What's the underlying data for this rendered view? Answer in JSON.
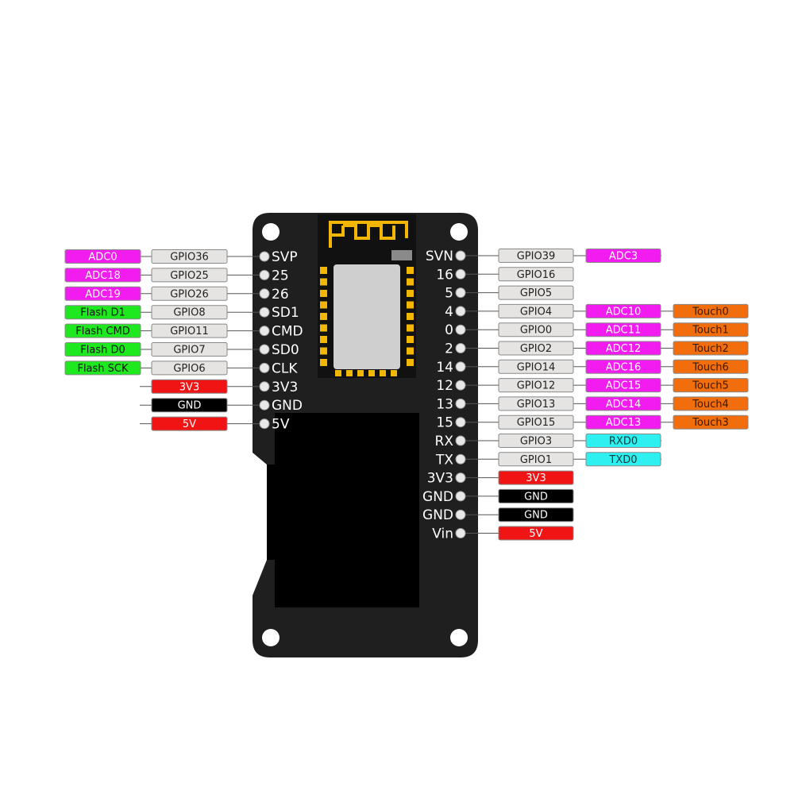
{
  "colors": {
    "board": "#1f1f1f",
    "screen": "#000000",
    "gold": "#f2b705",
    "gpio": "#e6e4e2",
    "adc": "#f21bf0",
    "flash": "#1ee81e",
    "power": "#f01414",
    "gnd": "#000000",
    "touch": "#f26d0c",
    "uart": "#2ef0f0"
  },
  "left_pins": [
    {
      "pin": "SVP",
      "tags": [
        {
          "text": "GPIO36",
          "type": "gpio"
        },
        {
          "text": "ADC0",
          "type": "adc"
        }
      ]
    },
    {
      "pin": "25",
      "tags": [
        {
          "text": "GPIO25",
          "type": "gpio"
        },
        {
          "text": "ADC18",
          "type": "adc"
        }
      ]
    },
    {
      "pin": "26",
      "tags": [
        {
          "text": "GPIO26",
          "type": "gpio"
        },
        {
          "text": "ADC19",
          "type": "adc"
        }
      ]
    },
    {
      "pin": "SD1",
      "tags": [
        {
          "text": "GPIO8",
          "type": "gpio"
        },
        {
          "text": "Flash D1",
          "type": "flash"
        }
      ]
    },
    {
      "pin": "CMD",
      "tags": [
        {
          "text": "GPIO11",
          "type": "gpio"
        },
        {
          "text": "Flash CMD",
          "type": "flash"
        }
      ]
    },
    {
      "pin": "SD0",
      "tags": [
        {
          "text": "GPIO7",
          "type": "gpio"
        },
        {
          "text": "Flash D0",
          "type": "flash"
        }
      ]
    },
    {
      "pin": "CLK",
      "tags": [
        {
          "text": "GPIO6",
          "type": "gpio"
        },
        {
          "text": "Flash SCK",
          "type": "flash"
        }
      ]
    },
    {
      "pin": "3V3",
      "tags": [
        {
          "text": "3V3",
          "type": "power"
        }
      ]
    },
    {
      "pin": "GND",
      "tags": [
        {
          "text": "GND",
          "type": "gnd"
        }
      ]
    },
    {
      "pin": "5V",
      "tags": [
        {
          "text": "5V",
          "type": "power"
        }
      ]
    }
  ],
  "right_pins": [
    {
      "pin": "SVN",
      "tags": [
        {
          "text": "GPIO39",
          "type": "gpio"
        },
        {
          "text": "ADC3",
          "type": "adc"
        }
      ]
    },
    {
      "pin": "16",
      "tags": [
        {
          "text": "GPIO16",
          "type": "gpio"
        }
      ]
    },
    {
      "pin": "5",
      "tags": [
        {
          "text": "GPIO5",
          "type": "gpio"
        }
      ]
    },
    {
      "pin": "4",
      "tags": [
        {
          "text": "GPIO4",
          "type": "gpio"
        },
        {
          "text": "ADC10",
          "type": "adc"
        },
        {
          "text": "Touch0",
          "type": "touch"
        }
      ]
    },
    {
      "pin": "0",
      "tags": [
        {
          "text": "GPIO0",
          "type": "gpio"
        },
        {
          "text": "ADC11",
          "type": "adc"
        },
        {
          "text": "Touch1",
          "type": "touch"
        }
      ]
    },
    {
      "pin": "2",
      "tags": [
        {
          "text": "GPIO2",
          "type": "gpio"
        },
        {
          "text": "ADC12",
          "type": "adc"
        },
        {
          "text": "Touch2",
          "type": "touch"
        }
      ]
    },
    {
      "pin": "14",
      "tags": [
        {
          "text": "GPIO14",
          "type": "gpio"
        },
        {
          "text": "ADC16",
          "type": "adc"
        },
        {
          "text": "Touch6",
          "type": "touch"
        }
      ]
    },
    {
      "pin": "12",
      "tags": [
        {
          "text": "GPIO12",
          "type": "gpio"
        },
        {
          "text": "ADC15",
          "type": "adc"
        },
        {
          "text": "Touch5",
          "type": "touch"
        }
      ]
    },
    {
      "pin": "13",
      "tags": [
        {
          "text": "GPIO13",
          "type": "gpio"
        },
        {
          "text": "ADC14",
          "type": "adc"
        },
        {
          "text": "Touch4",
          "type": "touch"
        }
      ]
    },
    {
      "pin": "15",
      "tags": [
        {
          "text": "GPIO15",
          "type": "gpio"
        },
        {
          "text": "ADC13",
          "type": "adc"
        },
        {
          "text": "Touch3",
          "type": "touch"
        }
      ]
    },
    {
      "pin": "RX",
      "tags": [
        {
          "text": "GPIO3",
          "type": "gpio"
        },
        {
          "text": "RXD0",
          "type": "uart"
        }
      ]
    },
    {
      "pin": "TX",
      "tags": [
        {
          "text": "GPIO1",
          "type": "gpio"
        },
        {
          "text": "TXD0",
          "type": "uart"
        }
      ]
    },
    {
      "pin": "3V3",
      "tags": [
        {
          "text": "3V3",
          "type": "power"
        }
      ]
    },
    {
      "pin": "GND",
      "tags": [
        {
          "text": "GND",
          "type": "gnd"
        }
      ]
    },
    {
      "pin": "GND",
      "tags": [
        {
          "text": "GND",
          "type": "gnd"
        }
      ]
    },
    {
      "pin": "Vin",
      "tags": [
        {
          "text": "5V",
          "type": "power"
        }
      ]
    }
  ]
}
